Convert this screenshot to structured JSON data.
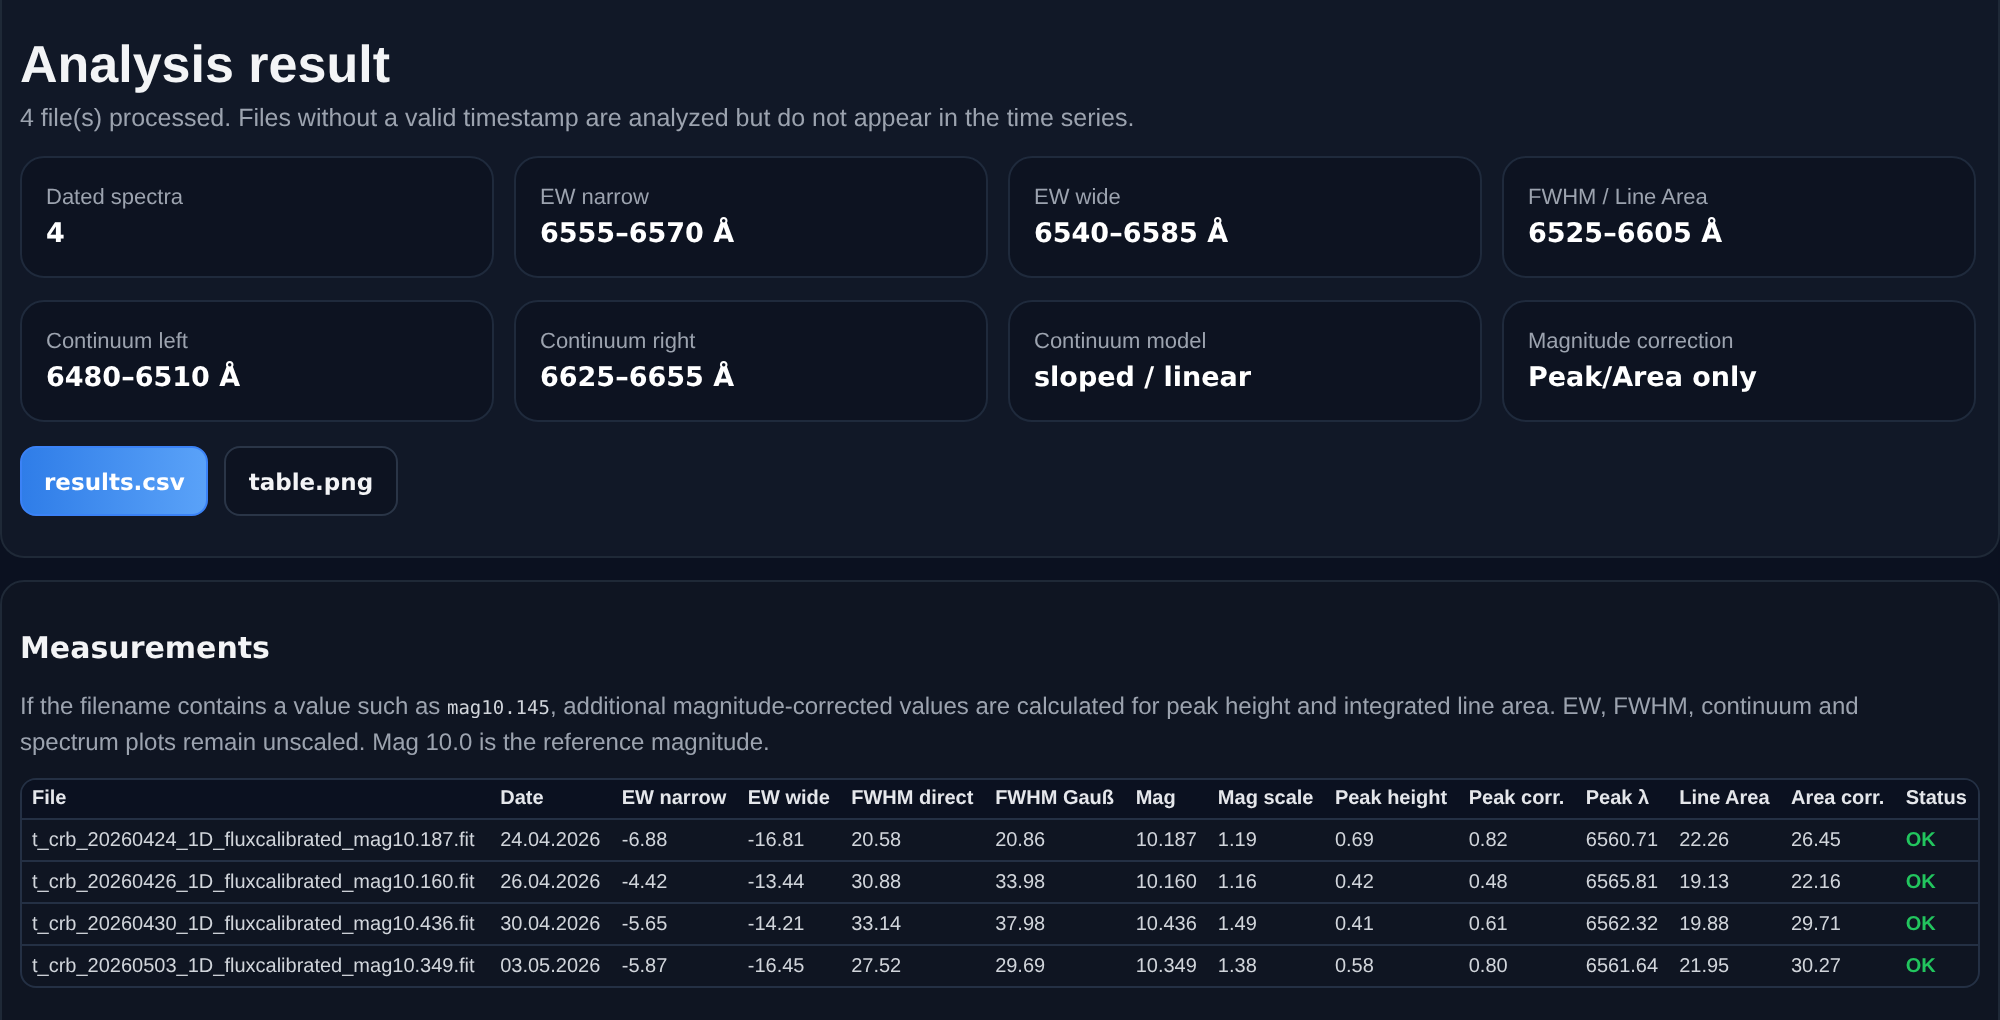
{
  "header": {
    "title": "Analysis result",
    "subtitle": "4 file(s) processed. Files without a valid timestamp are analyzed but do not appear in the time series."
  },
  "stats": [
    {
      "label": "Dated spectra",
      "value": "4"
    },
    {
      "label": "EW narrow",
      "value": "6555–6570 Å"
    },
    {
      "label": "EW wide",
      "value": "6540–6585 Å"
    },
    {
      "label": "FWHM / Line Area",
      "value": "6525–6605 Å"
    },
    {
      "label": "Continuum left",
      "value": "6480–6510 Å"
    },
    {
      "label": "Continuum right",
      "value": "6625–6655 Å"
    },
    {
      "label": "Continuum model",
      "value": "sloped / linear"
    },
    {
      "label": "Magnitude correction",
      "value": "Peak/Area only"
    }
  ],
  "downloads": [
    {
      "label": "results.csv",
      "primary": true
    },
    {
      "label": "table.png",
      "primary": false
    }
  ],
  "measurements": {
    "title": "Measurements",
    "description": {
      "before": "If the filename contains a value such as ",
      "code": "mag10.145",
      "after": ", additional magnitude-corrected values are calculated for peak height and integrated line area. EW, FWHM, continuum and spectrum plots remain unscaled. Mag 10.0 is the reference magnitude."
    },
    "table": {
      "columns": [
        "File",
        "Date",
        "EW narrow",
        "EW wide",
        "FWHM direct",
        "FWHM Gauß",
        "Mag",
        "Mag scale",
        "Peak height",
        "Peak corr.",
        "Peak λ",
        "Line Area",
        "Area corr.",
        "Status"
      ],
      "rows": [
        {
          "cells": [
            "t_crb_20260424_1D_fluxcalibrated_mag10.187.fit",
            "24.04.2026",
            "-6.88",
            "-16.81",
            "20.58",
            "20.86",
            "10.187",
            "1.19",
            "0.69",
            "0.82",
            "6560.71",
            "22.26",
            "26.45"
          ],
          "status": "OK",
          "ok": true
        },
        {
          "cells": [
            "t_crb_20260426_1D_fluxcalibrated_mag10.160.fit",
            "26.04.2026",
            "-4.42",
            "-13.44",
            "30.88",
            "33.98",
            "10.160",
            "1.16",
            "0.42",
            "0.48",
            "6565.81",
            "19.13",
            "22.16"
          ],
          "status": "OK",
          "ok": true
        },
        {
          "cells": [
            "t_crb_20260430_1D_fluxcalibrated_mag10.436.fit",
            "30.04.2026",
            "-5.65",
            "-14.21",
            "33.14",
            "37.98",
            "10.436",
            "1.49",
            "0.41",
            "0.61",
            "6562.32",
            "19.88",
            "29.71"
          ],
          "status": "OK",
          "ok": true
        },
        {
          "cells": [
            "t_crb_20260503_1D_fluxcalibrated_mag10.349.fit",
            "03.05.2026",
            "-5.87",
            "-16.45",
            "27.52",
            "29.69",
            "10.349",
            "1.38",
            "0.58",
            "0.80",
            "6561.64",
            "21.95",
            "30.27"
          ],
          "status": "OK",
          "ok": true
        }
      ]
    }
  }
}
